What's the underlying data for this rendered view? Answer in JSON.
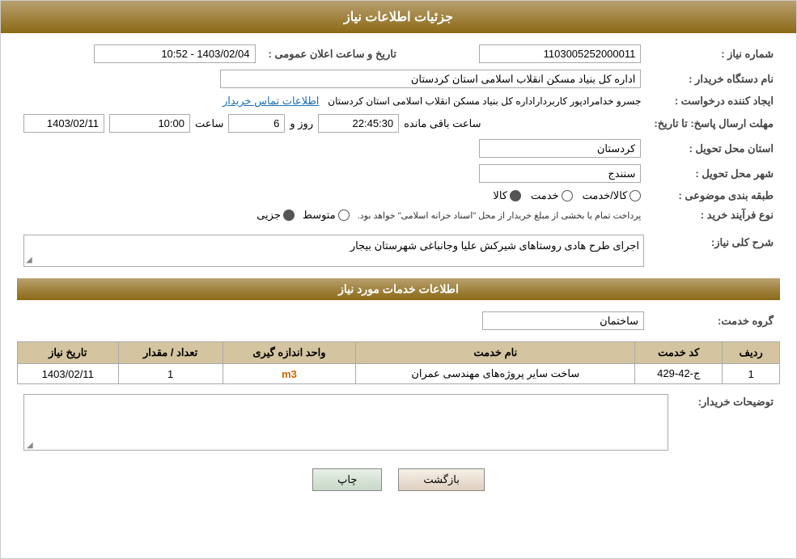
{
  "header": {
    "title": "جزئیات اطلاعات نیاز"
  },
  "fields": {
    "need_number_label": "شماره نیاز :",
    "need_number_value": "1103005252000011",
    "buyer_org_label": "نام دستگاه خریدار :",
    "buyer_org_value": "اداره کل بنیاد مسکن انقلاب اسلامی استان کردستان",
    "creator_label": "ایجاد کننده درخواست :",
    "creator_value": "جسرو خدامرادپور کاربرداراداره کل بنیاد مسکن انقلاب اسلامی استان کردستان",
    "contact_link": "اطلاعات تماس خریدار",
    "announce_date_label": "تاریخ و ساعت اعلان عمومی :",
    "announce_date_value": "1403/02/04 - 10:52",
    "reply_deadline_label": "مهلت ارسال پاسخ: تا تاریخ:",
    "reply_date_value": "1403/02/11",
    "reply_time_label": "ساعت",
    "reply_time_value": "10:00",
    "reply_days_label": "روز و",
    "reply_days_value": "6",
    "reply_remaining_label": "ساعت باقی مانده",
    "reply_remaining_value": "22:45:30",
    "delivery_province_label": "استان محل تحویل :",
    "delivery_province_value": "کردستان",
    "delivery_city_label": "شهر محل تحویل :",
    "delivery_city_value": "سنندج",
    "category_label": "طبقه بندی موضوعی :",
    "category_options": [
      "کالا",
      "خدمت",
      "کالا/خدمت"
    ],
    "category_selected": "کالا",
    "process_label": "نوع فرآیند خرید :",
    "process_options": [
      "جزیی",
      "متوسط"
    ],
    "process_note": "پرداخت تمام یا بخشی از مبلغ خریدار از محل \"اسناد خزانه اسلامی\" خواهد بود.",
    "description_label": "شرح کلی نیاز:",
    "description_value": "اجرای طرح هادی روستاهای شیرکش علیا وجانباغی شهرستان بیجار",
    "services_section_title": "اطلاعات خدمات مورد نیاز",
    "service_group_label": "گروه خدمت:",
    "service_group_value": "ساختمان",
    "table": {
      "columns": [
        "ردیف",
        "کد خدمت",
        "نام خدمت",
        "واحد اندازه گیری",
        "تعداد / مقدار",
        "تاریخ نیاز"
      ],
      "rows": [
        {
          "row_num": "1",
          "service_code": "ج-42-429",
          "service_name": "ساخت سایر پروژه‌های مهندسی عمران",
          "unit": "m3",
          "quantity": "1",
          "need_date": "1403/02/11"
        }
      ]
    },
    "buyer_notes_label": "توضیحات خریدار:",
    "buyer_notes_value": ""
  },
  "buttons": {
    "print_label": "چاپ",
    "back_label": "بازگشت"
  }
}
